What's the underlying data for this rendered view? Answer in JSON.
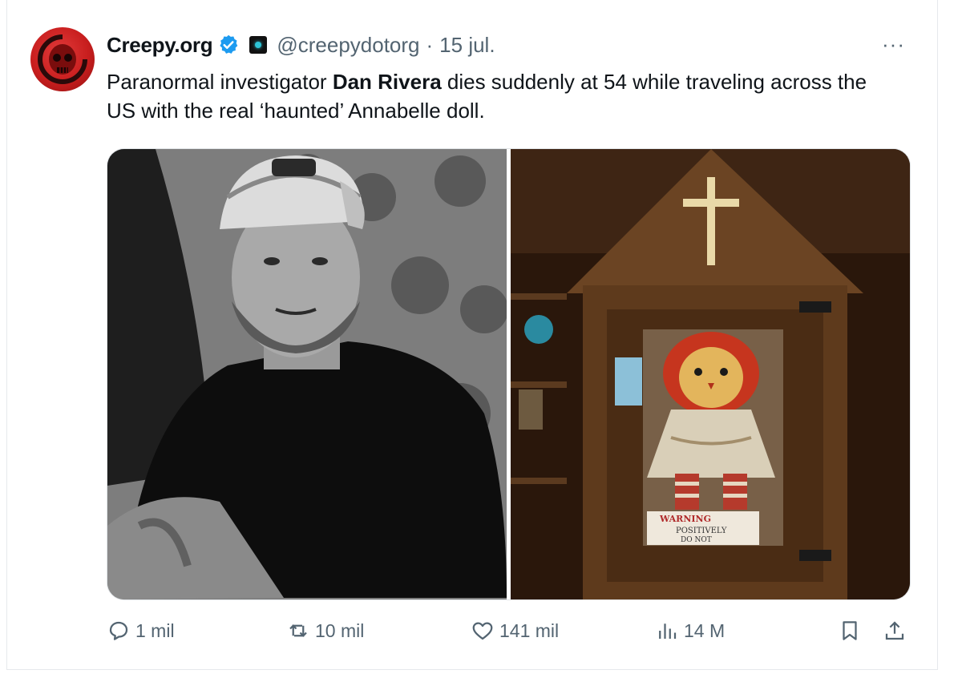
{
  "tweet": {
    "author_name": "Creepy.org",
    "handle": "@creepydotorg",
    "separator": "·",
    "date": "15 jul.",
    "more_label": "···",
    "text_prefix": "Paranormal investigator ",
    "text_bold": "Dan Rivera",
    "text_suffix": " dies suddenly at 54 while traveling across the US with the real ‘haunted’ Annabelle doll.",
    "media": [
      {
        "name": "photo-dan-rivera"
      },
      {
        "name": "photo-annabelle-doll",
        "sign_lines": [
          "WARNING",
          "POSITIVELY",
          "DO NOT"
        ]
      }
    ]
  },
  "actions": {
    "replies": "1 mil",
    "reposts": "10 mil",
    "likes": "141 mil",
    "views": "14 M"
  },
  "icons": {
    "avatar": "skull-logo-icon",
    "verified": "verified-badge-icon",
    "affiliate": "affiliate-badge-icon",
    "reply": "reply-icon",
    "repost": "repost-icon",
    "like": "heart-icon",
    "views": "views-icon",
    "bookmark": "bookmark-icon",
    "share": "share-icon"
  },
  "colors": {
    "text": "#0f1419",
    "secondary": "#536471",
    "verified": "#1d9bf0",
    "avatar_red": "#c81e1e"
  }
}
